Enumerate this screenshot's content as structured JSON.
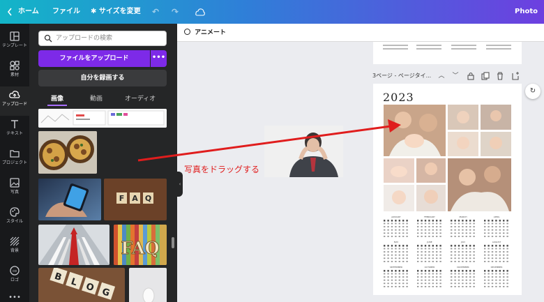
{
  "topbar": {
    "back_icon": "chevron-left-icon",
    "home_label": "ホーム",
    "file_label": "ファイル",
    "resize_label": "サイズを変更",
    "resize_icon": "sparkle-icon",
    "project_title": "Photo coll"
  },
  "rail": {
    "items": [
      {
        "label": "テンプレート",
        "icon": "template-icon"
      },
      {
        "label": "素材",
        "icon": "elements-icon"
      },
      {
        "label": "アップロード",
        "icon": "upload-icon"
      },
      {
        "label": "テキスト",
        "icon": "text-icon"
      },
      {
        "label": "プロジェクト",
        "icon": "folder-icon"
      },
      {
        "label": "写真",
        "icon": "photo-icon"
      },
      {
        "label": "スタイル",
        "icon": "palette-icon"
      },
      {
        "label": "背景",
        "icon": "background-icon"
      },
      {
        "label": "ロゴ",
        "icon": "logo-icon"
      }
    ]
  },
  "panel": {
    "search_placeholder": "アップロードの検索",
    "upload_button": "ファイルをアップロード",
    "more_button": "•••",
    "record_button": "自分を録画する",
    "tabs": [
      {
        "label": "画像",
        "active": true
      },
      {
        "label": "動画",
        "active": false
      },
      {
        "label": "オーディオ",
        "active": false
      }
    ],
    "thumbnails": [
      "chart-screenshot",
      "pizza",
      "smartphone-hand",
      "faq-tiles",
      "arrows-road",
      "faq-colorful",
      "blog-tiles",
      "egg"
    ]
  },
  "canvas": {
    "animate_label": "アニメート",
    "page_title": "3ページ - ページタイ...",
    "calendar_year": "2023",
    "months": [
      "JANUARY",
      "FEBRUARY",
      "MARCH",
      "APRIL",
      "MAY",
      "JUNE",
      "JULY",
      "AUGUST",
      "SEPTEMBER",
      "OCTOBER",
      "NOVEMBER",
      "DECEMBER"
    ],
    "drag_instruction": "写真をドラッグする",
    "accent_arrow_color": "#e01d1d"
  }
}
